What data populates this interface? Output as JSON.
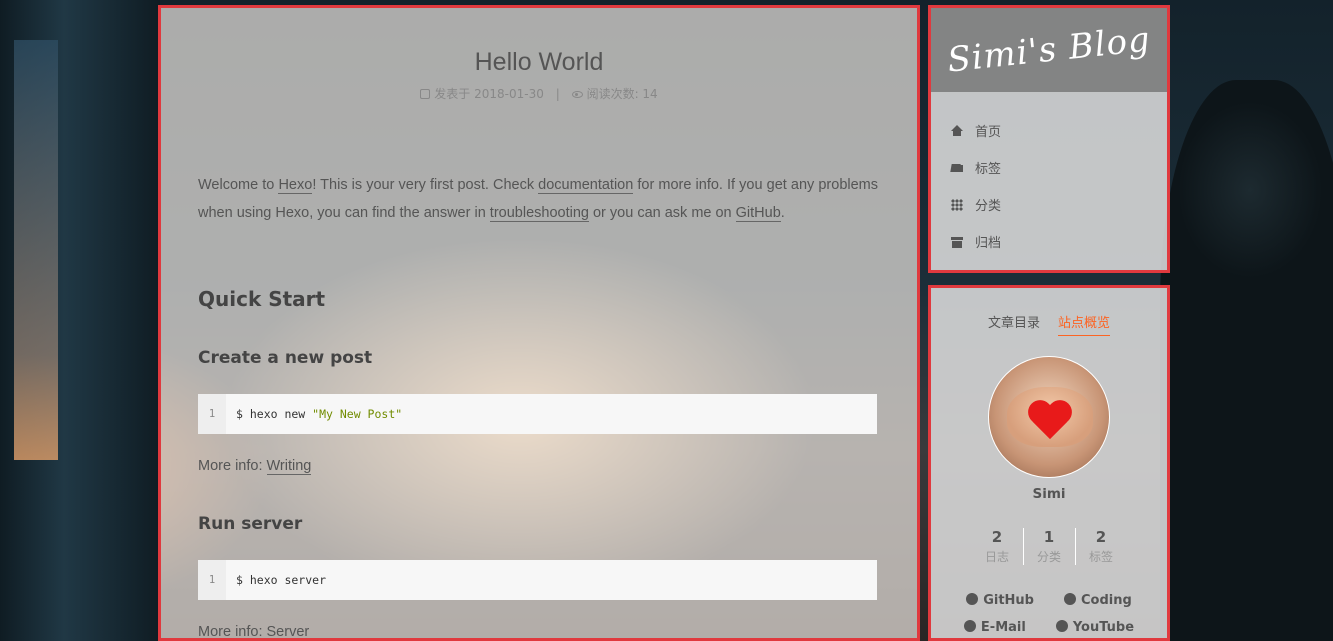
{
  "post": {
    "title": "Hello World",
    "meta_posted": "发表于 2018-01-30",
    "meta_separator": "|",
    "meta_views": "阅读次数: 14",
    "intro_parts": {
      "p1": "Welcome to ",
      "hexo": "Hexo",
      "p2": "! This is your very first post. Check ",
      "documentation": "documentation",
      "p3": " for more info. If you get any problems when using Hexo, you can find the answer in ",
      "troubleshooting": "troubleshooting",
      "p4": " or you can ask me on ",
      "github": "GitHub",
      "p5": "."
    },
    "quick_start": "Quick Start",
    "create_post": {
      "heading": "Create a new post",
      "line_no": "1",
      "cmd": "$ hexo new ",
      "arg": "\"My New Post\"",
      "more_prefix": "More info: ",
      "more_link": "Writing"
    },
    "run_server": {
      "heading": "Run server",
      "line_no": "1",
      "cmd": "$ hexo server",
      "more_prefix": "More info: ",
      "more_link": "Server"
    }
  },
  "sidebar": {
    "brand": "Simi's Blog",
    "menu": [
      {
        "label": "首页",
        "icon": "home-icon"
      },
      {
        "label": "标签",
        "icon": "tags-icon"
      },
      {
        "label": "分类",
        "icon": "grid-icon"
      },
      {
        "label": "归档",
        "icon": "archive-icon"
      }
    ],
    "tabs": {
      "toc": "文章目录",
      "overview": "站点概览"
    },
    "author": "Simi",
    "stats": [
      {
        "num": "2",
        "label": "日志"
      },
      {
        "num": "1",
        "label": "分类"
      },
      {
        "num": "2",
        "label": "标签"
      }
    ],
    "links": [
      {
        "label": "GitHub",
        "icon": "github-icon"
      },
      {
        "label": "Coding",
        "icon": "globe-icon"
      }
    ],
    "links_partial": [
      {
        "label": "E-Mail",
        "icon": "mail-icon"
      },
      {
        "label": "YouTube",
        "icon": "youtube-icon"
      }
    ]
  },
  "colors": {
    "accent": "#fc6423",
    "highlight_border": "#e0393e",
    "string": "#718c00"
  }
}
